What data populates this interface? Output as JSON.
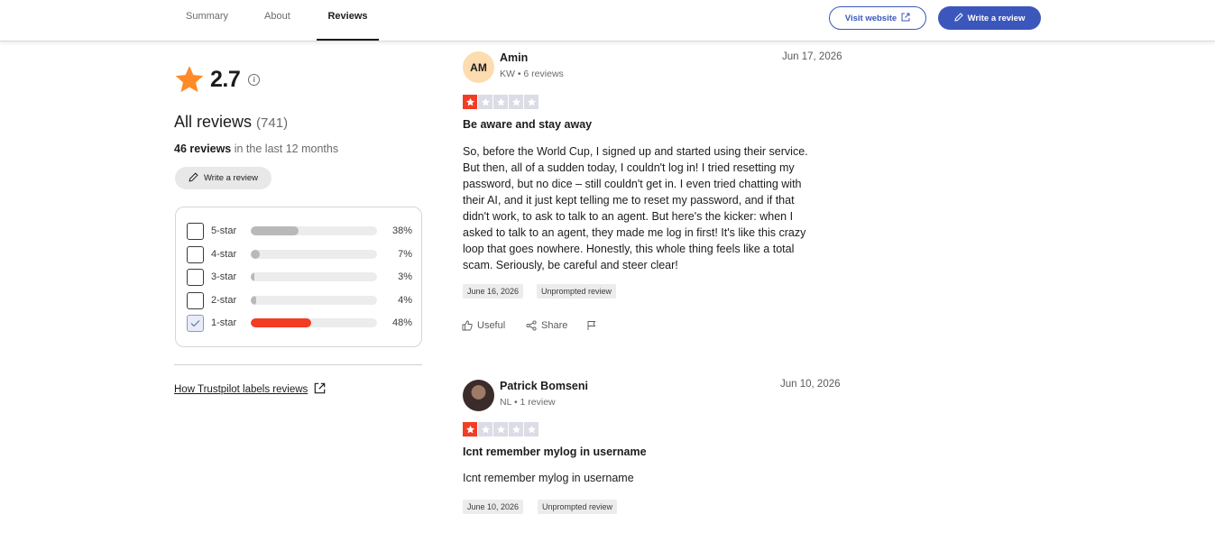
{
  "header": {
    "tabs": [
      {
        "label": "Summary",
        "active": false
      },
      {
        "label": "About",
        "active": false
      },
      {
        "label": "Reviews",
        "active": true
      }
    ],
    "visit_label": "Visit website",
    "write_label": "Write a review",
    "accent_color": "#3c57bc"
  },
  "summary": {
    "rating": "2.7",
    "all_reviews_label": "All reviews",
    "total_count": "(741)",
    "recent_count": "46 reviews",
    "recent_suffix": "in the last 12 months",
    "write_label": "Write a review",
    "filters": [
      {
        "label": "5-star",
        "percent_text": "38%",
        "percent": 38,
        "checked": false
      },
      {
        "label": "4-star",
        "percent_text": "7%",
        "percent": 7,
        "checked": false
      },
      {
        "label": "3-star",
        "percent_text": "3%",
        "percent": 3,
        "checked": false
      },
      {
        "label": "2-star",
        "percent_text": "4%",
        "percent": 4,
        "checked": false
      },
      {
        "label": "1-star",
        "percent_text": "48%",
        "percent": 48,
        "checked": true
      }
    ],
    "labels_link": "How Trustpilot labels reviews",
    "star_color": "#ff8a26",
    "one_star_color": "#f23d24"
  },
  "reviews": [
    {
      "initials": "AM",
      "name": "Amin",
      "meta": "KW • 6 reviews",
      "date": "Jun 17, 2026",
      "stars": 1,
      "title": "Be aware and stay away",
      "body": [
        "So, before the World Cup, I signed up and started using their service.",
        "But then, all of a sudden today, I couldn't log in! I tried resetting my",
        "password, but no dice – still couldn't get in. I even tried chatting with",
        "their AI, and it just kept telling me to reset my password, and if that",
        "didn't work, to ask to talk to an agent. But here's the kicker: when I",
        "asked to talk to an agent, they made me log in first! It's like this crazy",
        "loop that goes nowhere. Honestly, this whole thing feels like a total",
        "scam. Seriously, be careful and steer clear!"
      ],
      "exp_date": "June 16, 2026",
      "tag": "Unprompted review",
      "useful": "Useful",
      "share": "Share"
    },
    {
      "initials": "",
      "name": "Patrick Bomseni",
      "meta": "NL • 1 review",
      "date": "Jun 10, 2026",
      "stars": 1,
      "title": "Icnt remember mylog in username",
      "body": [
        "Icnt remember mylog in username"
      ],
      "exp_date": "June 10, 2026",
      "tag": "Unprompted review"
    }
  ]
}
